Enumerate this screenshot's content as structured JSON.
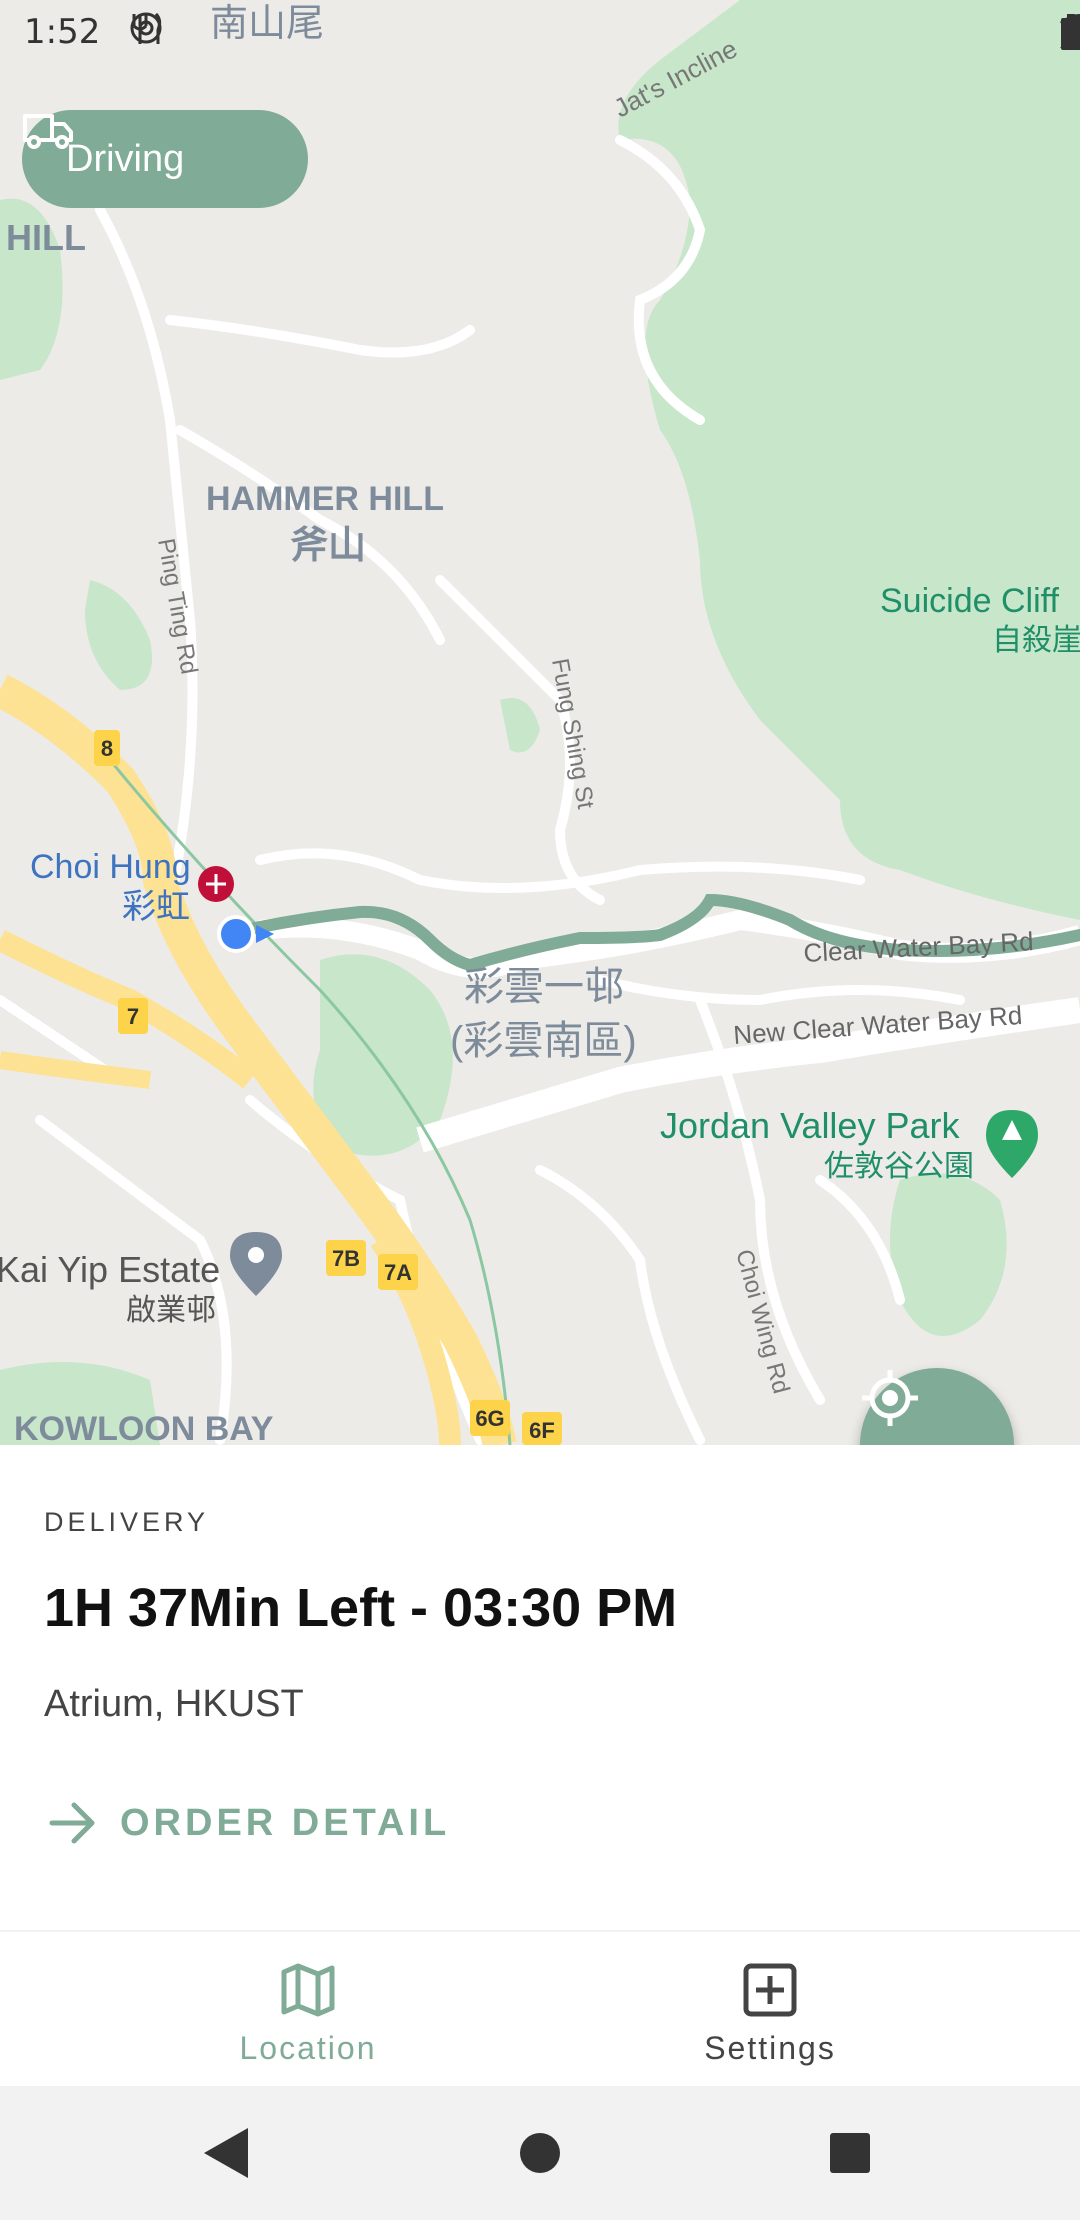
{
  "status_bar": {
    "time": "1:52"
  },
  "map": {
    "labels": {
      "top_cut": "南山尾",
      "hill_cut": "HILL",
      "jats_incline": "Jat's Incline",
      "hammer_hill_en": "HAMMER HILL",
      "hammer_hill_zh": "斧山",
      "ping_ting_rd": "Ping Ting Rd",
      "suicide_cliff_en": "Suicide Cliff",
      "suicide_cliff_zh": "自殺崖",
      "fung_shing_st": "Fung Shing St",
      "choi_hung_en": "Choi Hung",
      "choi_hung_zh": "彩虹",
      "choi_wan_1": "彩雲一邨",
      "choi_wan_2": "(彩雲南區)",
      "clear_water_bay_rd": "Clear Water Bay Rd",
      "new_clear_water_bay_rd": "New Clear Water Bay Rd",
      "jordan_valley_en": "Jordan Valley Park",
      "jordan_valley_zh": "佐敦谷公園",
      "kai_yip_en": "Kai Yip Estate",
      "kai_yip_zh": "啟業邨",
      "choi_wing_rd": "Choi Wing Rd",
      "kowloon_bay": "KOWLOON BAY"
    },
    "route_shields": [
      "8",
      "7",
      "7B",
      "7A",
      "6G",
      "6F"
    ],
    "colors": {
      "park": "#c8e6c9",
      "road_major": "#fde293",
      "route": "#7fab97",
      "location_dot": "#4285f4"
    }
  },
  "mode_chip": {
    "icon": "truck-icon",
    "label": "Driving"
  },
  "locate_button": {
    "icon": "crosshair-icon"
  },
  "delivery": {
    "label": "DELIVERY",
    "title": "1H 37Min Left - 03:30 PM",
    "address": "Atrium, HKUST",
    "order_detail": "ORDER DETAIL"
  },
  "bottom_nav": {
    "items": [
      {
        "label": "Location",
        "icon": "map-icon",
        "active": true
      },
      {
        "label": "Settings",
        "icon": "plus-box-icon",
        "active": false
      }
    ]
  },
  "accent_color": "#7fab97"
}
